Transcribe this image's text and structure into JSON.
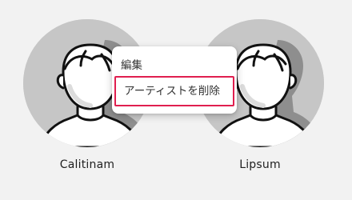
{
  "artists": [
    {
      "name": "Calitinam"
    },
    {
      "name": "Lipsum"
    }
  ],
  "context_menu": {
    "edit_label": "編集",
    "delete_label": "アーティストを削除",
    "highlight_color": "#e01f4f"
  },
  "icons": {
    "avatar": "person-placeholder-icon"
  }
}
